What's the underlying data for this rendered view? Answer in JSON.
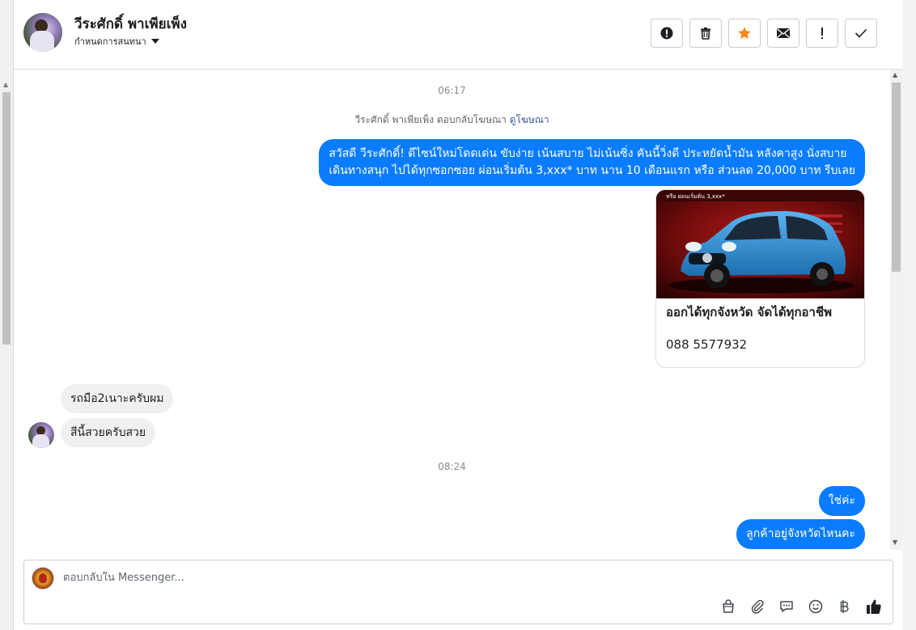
{
  "header": {
    "contact_name": "วีระศักดิ์ พาเพียเพ็ง",
    "conversation_menu_label": "กำหนดการสนทนา",
    "actions": [
      {
        "name": "report-spam",
        "icon": "alert-circle-icon"
      },
      {
        "name": "delete",
        "icon": "trash-icon"
      },
      {
        "name": "star",
        "icon": "star-icon",
        "color": "#f5881f"
      },
      {
        "name": "mark-unread",
        "icon": "envelope-icon"
      },
      {
        "name": "follow-up",
        "icon": "exclamation-icon"
      },
      {
        "name": "mark-done",
        "icon": "check-icon"
      }
    ]
  },
  "chat": {
    "timestamp_1": "06:17",
    "ad_reply_note": "วีระศักดิ์ พาเพียเพ็ง ตอบกลับโฆษณา",
    "ad_reply_link": "ดูโฆษณา",
    "outgoing_intro_line1": "สวัสดี วีระศักดิ์! ดีไซน์ใหม่โดดเด่น ขับง่าย เน้นสบาย ไม่เน้นซิ่ง คันนี้วิ่งดี ประหยัดน้ำมัน หลังคาสูง นั่งสบาย",
    "outgoing_intro_line2": "เดินทางสนุก ไปได้ทุกซอกซอย ผ่อนเริ่มต้น 3,xxx* บาท นาน 10 เดือนแรก หรือ ส่วนลด 20,000 บาท รีบเลย",
    "ad_card": {
      "banner_text": "หรือ ผ่อนเริ่มต้น 3,xxx*",
      "caption": "ออกได้ทุกจังหวัด จัดได้ทุกอาชีพ",
      "phone": "088 5577932"
    },
    "incoming_1": "รถมือ2เนาะครับผม",
    "incoming_2": "สีนี้สวยครับสวย",
    "timestamp_2": "08:24",
    "outgoing_reply_1": "ใช่ค่ะ",
    "outgoing_reply_2": "ลูกค้าอยู่จังหวัดไหนคะ"
  },
  "composer": {
    "placeholder": "ตอบกลับใน Messenger...",
    "tools": [
      "bag-icon",
      "paperclip-icon",
      "saved-replies-icon",
      "emoji-icon",
      "baht-icon",
      "thumbs-up-icon"
    ]
  },
  "colors": {
    "outgoing_bubble": "#0a7cff",
    "incoming_bubble": "#f0f0f0",
    "link": "#385898"
  }
}
